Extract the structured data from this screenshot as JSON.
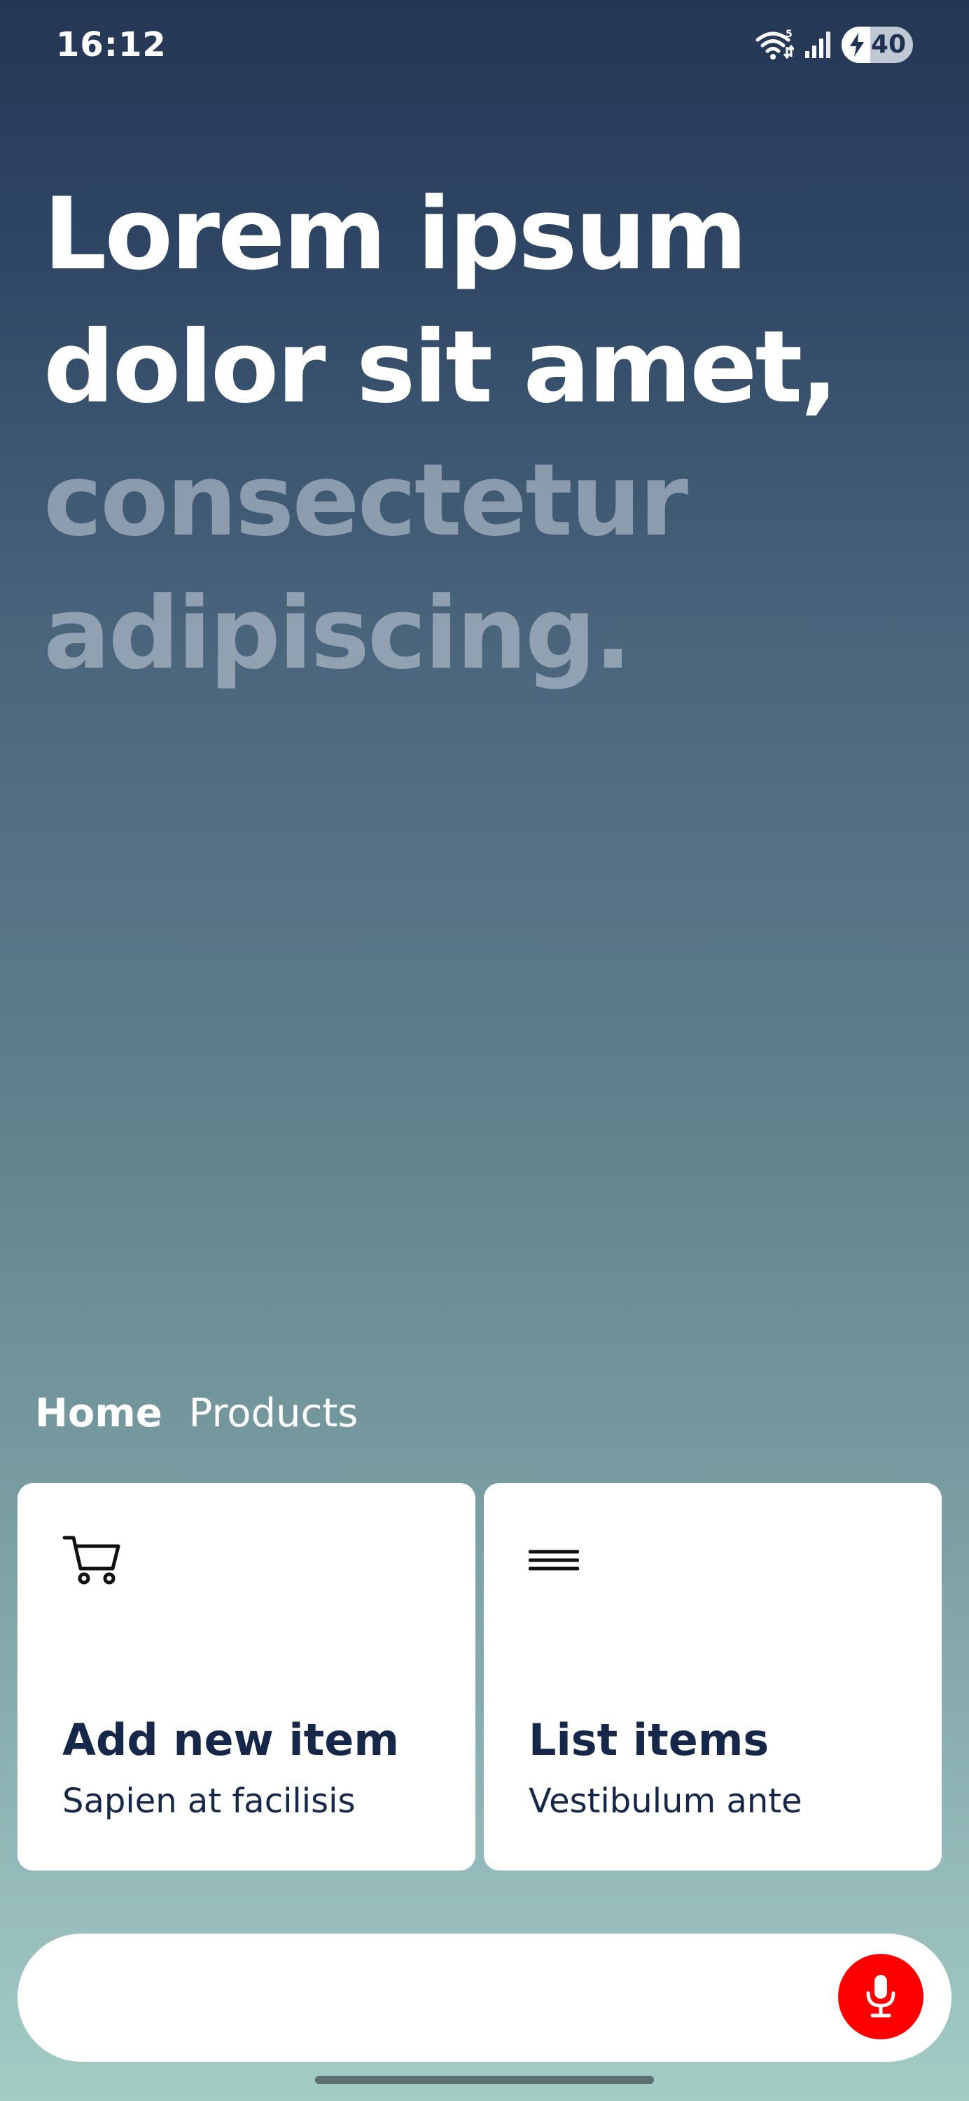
{
  "status_bar": {
    "time": "16:12",
    "wifi_badge": "5",
    "battery_level": "40",
    "battery_fraction": 0.4,
    "icons": [
      "wifi-icon",
      "signal-icon",
      "battery-charging-icon"
    ]
  },
  "hero": {
    "line1": "Lorem ipsum",
    "line2": "dolor sit amet,",
    "line3": "consectetur",
    "line4": "adipiscing."
  },
  "tabs": [
    {
      "label": "Home",
      "active": true
    },
    {
      "label": "Products",
      "active": false
    }
  ],
  "cards": [
    {
      "icon": "cart-icon",
      "title": "Add new item",
      "subtitle": "Sapien at facilisis"
    },
    {
      "icon": "menu-icon",
      "title": "List items",
      "subtitle": "Vestibulum ante"
    }
  ],
  "input_bar": {
    "value": "",
    "placeholder": "",
    "mic_icon": "microphone-icon",
    "mic_color": "#ff0000"
  },
  "colors": {
    "gradient_top": "#243755",
    "gradient_bottom": "#a3ccc4",
    "card_text": "#16274a",
    "mic": "#ff0000"
  }
}
